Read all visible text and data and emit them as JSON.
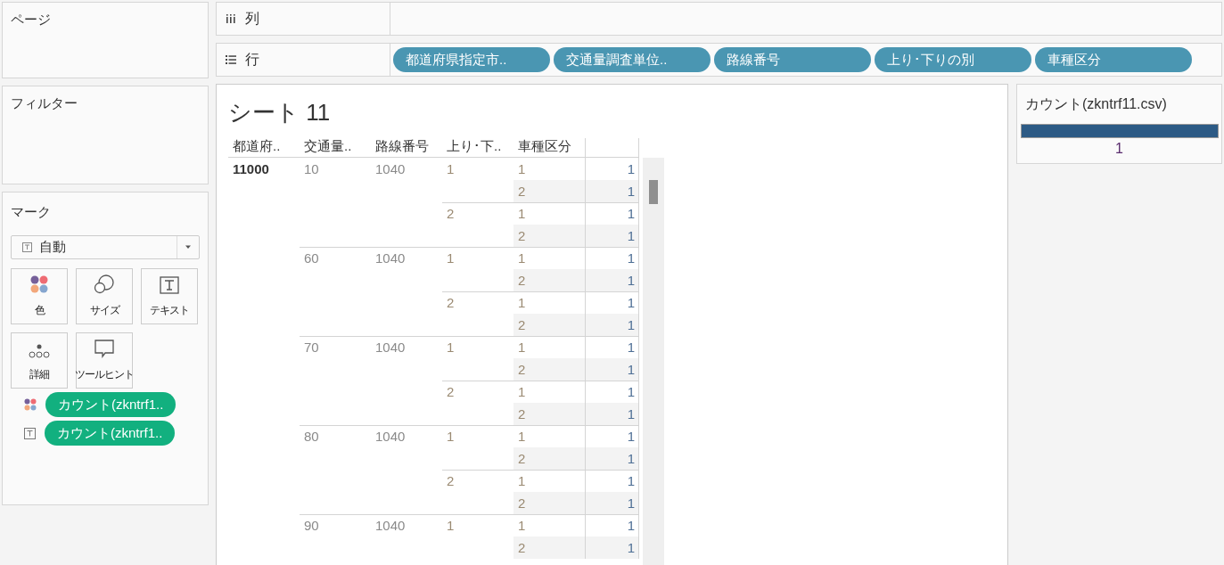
{
  "pages_panel": {
    "title": "ページ"
  },
  "columns_shelf": {
    "label": "列"
  },
  "rows_shelf": {
    "label": "行",
    "pills": [
      "都道府県指定市..",
      "交通量調査単位..",
      "路線番号",
      "上り･下りの別",
      "車種区分"
    ]
  },
  "filters_panel": {
    "title": "フィルター"
  },
  "marks_panel": {
    "title": "マーク",
    "mark_type": "自動",
    "buttons": [
      {
        "kind": "color",
        "label": "色"
      },
      {
        "kind": "size",
        "label": "サイズ"
      },
      {
        "kind": "text",
        "label": "テキスト"
      },
      {
        "kind": "detail",
        "label": "詳細"
      },
      {
        "kind": "tooltip",
        "label": "ツールヒント"
      }
    ],
    "fields": [
      {
        "kind": "color",
        "label": "カウント(zkntrf1.."
      },
      {
        "kind": "text",
        "label": "カウント(zkntrf1.."
      }
    ]
  },
  "sheet": {
    "title": "シート 11",
    "headers": [
      "都道府..",
      "交通量..",
      "路線番号",
      "上り･下..",
      "車種区分"
    ],
    "rows": [
      {
        "pref": "11000",
        "groups": [
          {
            "unit": "10",
            "route": "1040",
            "directions": [
              {
                "dir": "1",
                "types": [
                  {
                    "type": "1",
                    "count": "1"
                  },
                  {
                    "type": "2",
                    "count": "1"
                  }
                ]
              },
              {
                "dir": "2",
                "types": [
                  {
                    "type": "1",
                    "count": "1"
                  },
                  {
                    "type": "2",
                    "count": "1"
                  }
                ]
              }
            ]
          },
          {
            "unit": "60",
            "route": "1040",
            "directions": [
              {
                "dir": "1",
                "types": [
                  {
                    "type": "1",
                    "count": "1"
                  },
                  {
                    "type": "2",
                    "count": "1"
                  }
                ]
              },
              {
                "dir": "2",
                "types": [
                  {
                    "type": "1",
                    "count": "1"
                  },
                  {
                    "type": "2",
                    "count": "1"
                  }
                ]
              }
            ]
          },
          {
            "unit": "70",
            "route": "1040",
            "directions": [
              {
                "dir": "1",
                "types": [
                  {
                    "type": "1",
                    "count": "1"
                  },
                  {
                    "type": "2",
                    "count": "1"
                  }
                ]
              },
              {
                "dir": "2",
                "types": [
                  {
                    "type": "1",
                    "count": "1"
                  },
                  {
                    "type": "2",
                    "count": "1"
                  }
                ]
              }
            ]
          },
          {
            "unit": "80",
            "route": "1040",
            "directions": [
              {
                "dir": "1",
                "types": [
                  {
                    "type": "1",
                    "count": "1"
                  },
                  {
                    "type": "2",
                    "count": "1"
                  }
                ]
              },
              {
                "dir": "2",
                "types": [
                  {
                    "type": "1",
                    "count": "1"
                  },
                  {
                    "type": "2",
                    "count": "1"
                  }
                ]
              }
            ]
          },
          {
            "unit": "90",
            "route": "1040",
            "directions": [
              {
                "dir": "1",
                "types": [
                  {
                    "type": "1",
                    "count": "1"
                  },
                  {
                    "type": "2",
                    "count": "1"
                  }
                ]
              }
            ]
          }
        ]
      }
    ]
  },
  "legend": {
    "title": "カウント(zkntrf11.csv)",
    "value": "1"
  }
}
